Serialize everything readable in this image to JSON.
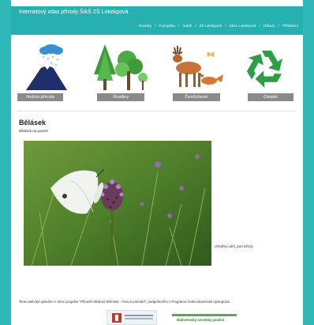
{
  "header": {
    "title": "Internetový atlas přírody ŠIkŠ ZŠ Lokekpová",
    "nav": [
      "Novinky",
      "O projektu",
      "Autoři",
      "ZŠ Lokekpová",
      "Obec Lokekpová",
      "Odkazy",
      "Přihlášení"
    ]
  },
  "categories": [
    {
      "label": "Neživá příroda",
      "icon": "snow-cloud-mountain-icon"
    },
    {
      "label": "Rostliny",
      "icon": "trees-icon"
    },
    {
      "label": "Živočichové",
      "icon": "deer-fox-butterfly-icon"
    },
    {
      "label": "Ostatní",
      "icon": "recycle-icon"
    }
  ],
  "species": {
    "title": "Bělásek",
    "subtitle": "Bělásek na pastvě",
    "credit": "(Ondřej Lukš, jaro 2013)"
  },
  "footer": {
    "note": "Tento web byl vytvořen v rámci projektu \"Přírodní dědictví těšínska – hrou k poznání\", podpořeného z Programu česko-slovenské spolupráce.",
    "partner": "Malčzemsky čevelsky pozitivi"
  },
  "colors": {
    "teal": "#27b0b0",
    "label_gray": "#8a8a88",
    "recycle_green": "#2e9e45"
  }
}
